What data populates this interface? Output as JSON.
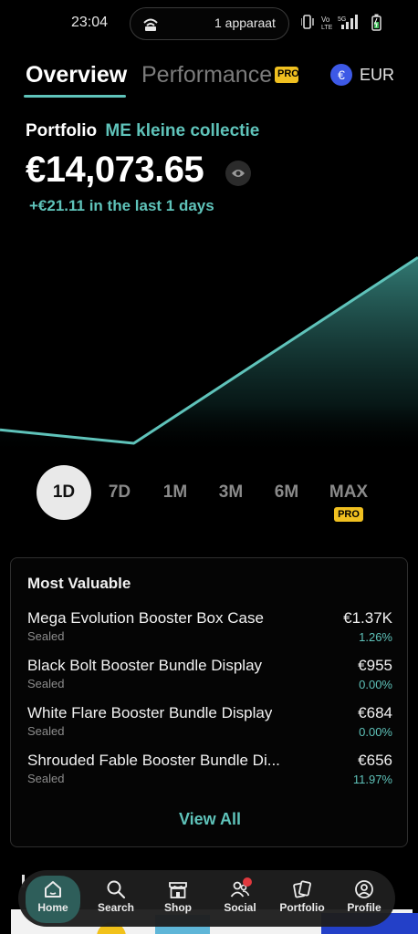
{
  "status_bar": {
    "time": "23:04",
    "hotspot_label": "1 apparaat"
  },
  "tabs": {
    "overview": "Overview",
    "performance": "Performance",
    "performance_badge": "PRO",
    "currency_symbol": "€",
    "currency_label": "EUR"
  },
  "portfolio": {
    "label": "Portfolio",
    "name": "ME kleine collectie",
    "value": "€14,073.65",
    "change": "+€21.11 in the last 1 days"
  },
  "chart_data": {
    "type": "area",
    "x": [
      0,
      0.32,
      1
    ],
    "y": [
      14052.54,
      14050.9,
      14073.65
    ],
    "color": "#5fc3ba",
    "grid": false,
    "xlabel": "",
    "ylabel": ""
  },
  "ranges": {
    "items": [
      "1D",
      "7D",
      "1M",
      "3M",
      "6M",
      "MAX"
    ],
    "active": "1D",
    "max_badge": "PRO"
  },
  "most_valuable": {
    "title": "Most Valuable",
    "items": [
      {
        "name": "Mega Evolution Booster Box Case",
        "type": "Sealed",
        "price": "€1.37K",
        "change": "1.26%"
      },
      {
        "name": "Black Bolt Booster Bundle Display",
        "type": "Sealed",
        "price": "€955",
        "change": "0.00%"
      },
      {
        "name": "White Flare Booster Bundle Display",
        "type": "Sealed",
        "price": "€684",
        "change": "0.00%"
      },
      {
        "name": "Shrouded Fable Booster Bundle Di...",
        "type": "Sealed",
        "price": "€656",
        "change": "11.97%"
      }
    ],
    "view_all": "View All"
  },
  "nav": {
    "home": "Home",
    "search": "Search",
    "shop": "Shop",
    "social": "Social",
    "portfolio": "Portfolio",
    "profile": "Profile"
  },
  "colors": {
    "accent": "#5fc3ba",
    "pro": "#f0c020",
    "currency": "#3d59e6"
  }
}
